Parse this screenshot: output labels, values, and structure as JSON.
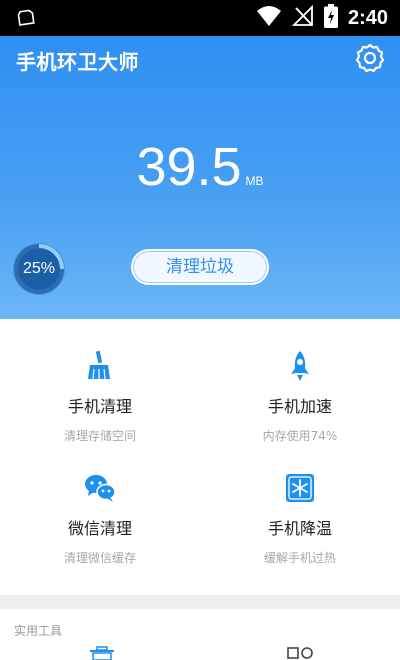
{
  "status_bar": {
    "time": "2:40",
    "icons": [
      "sd-card-icon",
      "wifi-icon",
      "no-signal-icon",
      "battery-charging-icon"
    ]
  },
  "header": {
    "title": "手机环卫大师",
    "settings_icon": "gear-icon"
  },
  "junk": {
    "value": "39.5",
    "unit": "MB",
    "progress_percent": 25,
    "progress_label": "25%",
    "clean_button_label": "清理垃圾"
  },
  "features": [
    {
      "title": "手机清理",
      "subtitle": "清理存储空间",
      "icon": "broom-icon"
    },
    {
      "title": "手机加速",
      "subtitle": "内存使用74%",
      "icon": "rocket-icon"
    },
    {
      "title": "微信清理",
      "subtitle": "清理微信缓存",
      "icon": "wechat-icon"
    },
    {
      "title": "手机降温",
      "subtitle": "缓解手机过热",
      "icon": "snowflake-icon"
    }
  ],
  "tools": {
    "section_label": "实用工具"
  },
  "colors": {
    "accent": "#2f8ff2",
    "header_top": "#2f8ff2",
    "header_bottom": "#6bb6f6",
    "icon_blue": "#1e90f0"
  }
}
